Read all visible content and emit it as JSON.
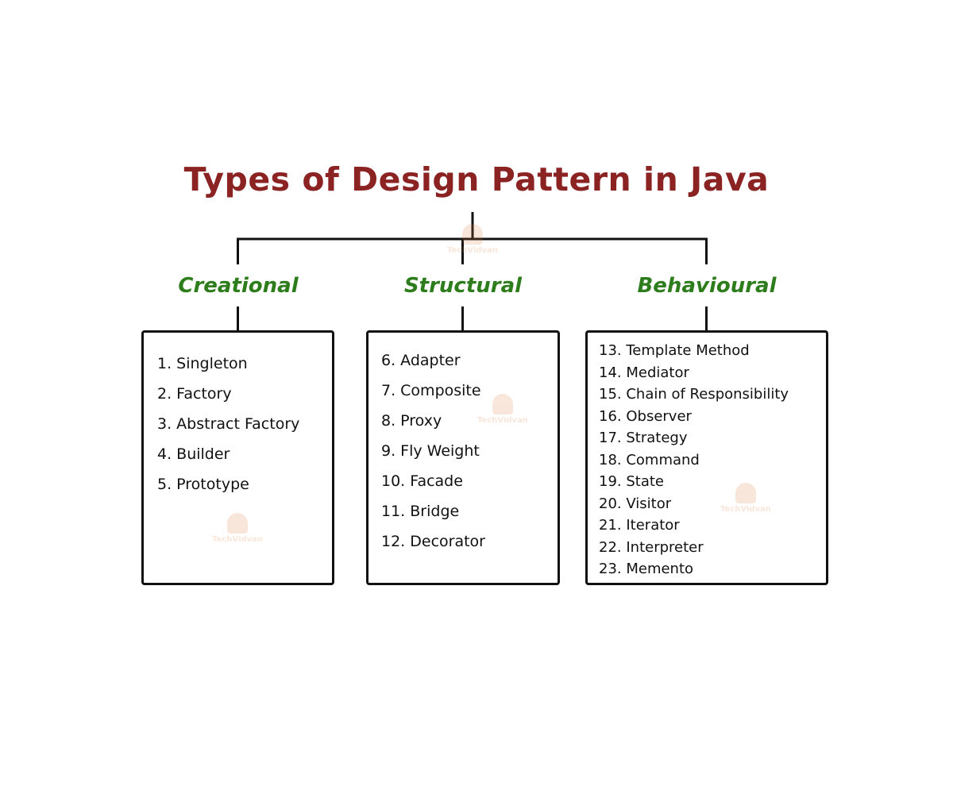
{
  "title": "Types of Design Pattern in Java",
  "watermark_text": "TechVidvan",
  "colors": {
    "title": "#8b2323",
    "category": "#2e7d1c",
    "line": "#111111"
  },
  "categories": [
    {
      "label": "Creational",
      "items": [
        "1. Singleton",
        "2. Factory",
        "3. Abstract Factory",
        "4. Builder",
        "5. Prototype"
      ]
    },
    {
      "label": "Structural",
      "items": [
        "6. Adapter",
        "7. Composite",
        "8. Proxy",
        "9. Fly Weight",
        "10. Facade",
        "11. Bridge",
        "12. Decorator"
      ]
    },
    {
      "label": "Behavioural",
      "items": [
        "13. Template Method",
        "14. Mediator",
        "15. Chain of Responsibility",
        "16. Observer",
        "17. Strategy",
        "18. Command",
        "19. State",
        "20. Visitor",
        "21. Iterator",
        "22. Interpreter",
        "23. Memento"
      ]
    }
  ]
}
